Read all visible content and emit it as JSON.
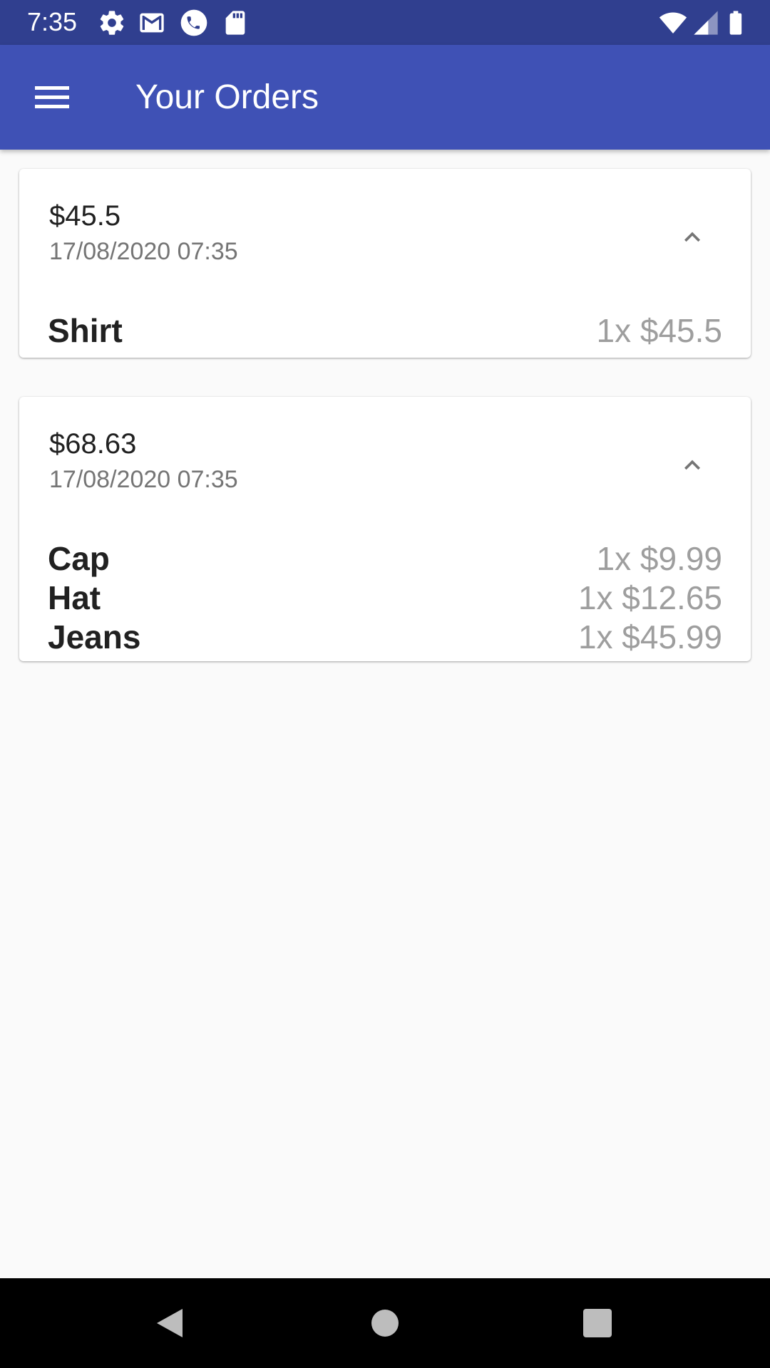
{
  "status_bar": {
    "time": "7:35",
    "icons_left": [
      "gear-icon",
      "gmail-icon",
      "phone-icon",
      "sd-card-icon"
    ],
    "icons_right": [
      "wifi-icon",
      "signal-icon",
      "battery-icon"
    ]
  },
  "app_bar": {
    "title": "Your Orders",
    "menu_icon": "hamburger-menu-icon"
  },
  "orders": [
    {
      "total": "$45.5",
      "date": "17/08/2020 07:35",
      "expanded": true,
      "items": [
        {
          "name": "Shirt",
          "price": "1x $45.5"
        }
      ]
    },
    {
      "total": "$68.63",
      "date": "17/08/2020 07:35",
      "expanded": true,
      "items": [
        {
          "name": "Cap",
          "price": "1x $9.99"
        },
        {
          "name": "Hat",
          "price": "1x $12.65"
        },
        {
          "name": "Jeans",
          "price": "1x $45.99"
        }
      ]
    }
  ],
  "nav_bar": {
    "buttons": [
      "back-icon",
      "home-icon",
      "recents-icon"
    ]
  },
  "colors": {
    "status_bar": "#303f8f",
    "app_bar": "#3f51b5",
    "background": "#fafafa",
    "item_price": "#9e9e9e"
  }
}
